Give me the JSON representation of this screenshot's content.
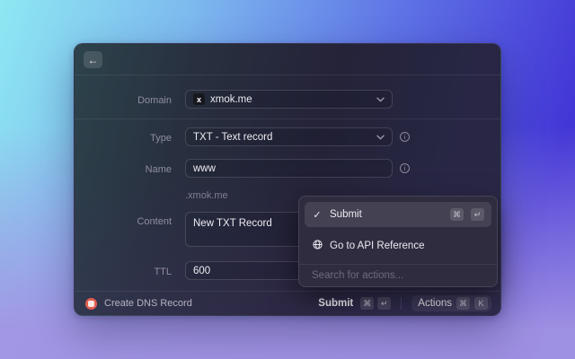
{
  "window": {
    "header": {
      "back_icon": "←"
    },
    "form": {
      "domain": {
        "label": "Domain",
        "favicon_glyph": "x",
        "value": "xmok.me"
      },
      "type": {
        "label": "Type",
        "value": "TXT - Text record"
      },
      "name": {
        "label": "Name",
        "value": "www",
        "suffix_hint": ".xmok.me"
      },
      "content": {
        "label": "Content",
        "value": "New TXT Record"
      },
      "ttl": {
        "label": "TTL",
        "value": "600"
      }
    },
    "footer": {
      "app_title": "Create DNS Record",
      "submit": {
        "label": "Submit",
        "key_cmd": "⌘",
        "key_enter": "↵"
      },
      "actions": {
        "label": "Actions",
        "key_cmd": "⌘",
        "key_k": "K"
      }
    }
  },
  "popup": {
    "submit_item": {
      "check_glyph": "✓",
      "label": "Submit",
      "key_cmd": "⌘",
      "key_enter": "↵"
    },
    "api_item": {
      "label": "Go to API Reference"
    },
    "search_placeholder": "Search for actions..."
  },
  "icons": {
    "info_glyph": "i",
    "chevron_down": "⌄",
    "back": "←",
    "check": "✓",
    "globe": "globe-icon",
    "app": "red-circle-app-icon"
  },
  "colors": {
    "accent_red": "#e25c52",
    "popup_bg": "#2f2c3f",
    "selected_row": "rgba(255,255,255,0.10)",
    "bg_gradient_top_left": "#8ee7f2",
    "bg_gradient_top_right": "#4336d6",
    "bg_gradient_bottom": "#a394e3"
  }
}
